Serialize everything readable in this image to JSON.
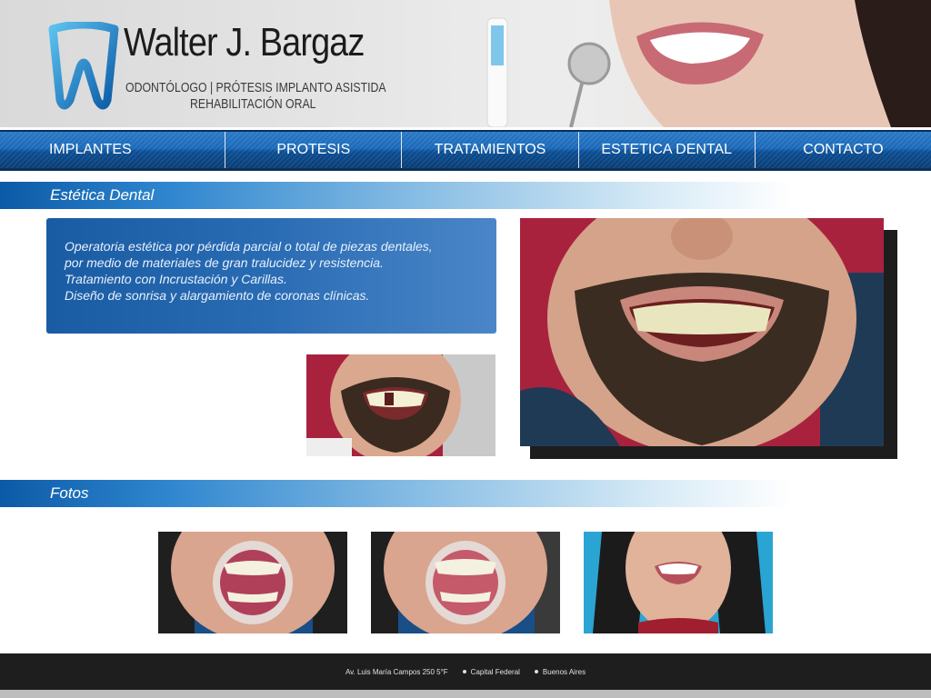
{
  "header": {
    "brand_name": "Walter J. Bargaz",
    "subtitle_line1": "ODONTÓLOGO | PRÓTESIS IMPLANTO ASISTIDA",
    "subtitle_line2": "REHABILITACIÓN ORAL",
    "logo_icon": "tooth-w-logo-icon"
  },
  "nav": {
    "items": [
      {
        "label": "IMPLANTES"
      },
      {
        "label": "PROTESIS"
      },
      {
        "label": "TRATAMIENTOS"
      },
      {
        "label": "ESTETICA DENTAL"
      },
      {
        "label": "CONTACTO"
      }
    ]
  },
  "sections": {
    "estetica_title": "Estética Dental",
    "fotos_title": "Fotos"
  },
  "description": {
    "lines": [
      "Operatoria estética por pérdida parcial o total de piezas dentales,",
      "por medio de materiales de gran tralucidez y resistencia.",
      "Tratamiento con Incrustación y Carillas.",
      "Diseño de sonrisa y alargamiento de coronas clínicas."
    ]
  },
  "footer": {
    "address": "Av. Luis María Campos 250 5°F",
    "city": "Capital Federal",
    "region": "Buenos Aires"
  },
  "colors": {
    "nav_blue": "#1b6cbd",
    "nav_dark": "#0a2f5c",
    "accent_blue": "#0c5aa7",
    "footer_bg": "#1e1e1e"
  }
}
